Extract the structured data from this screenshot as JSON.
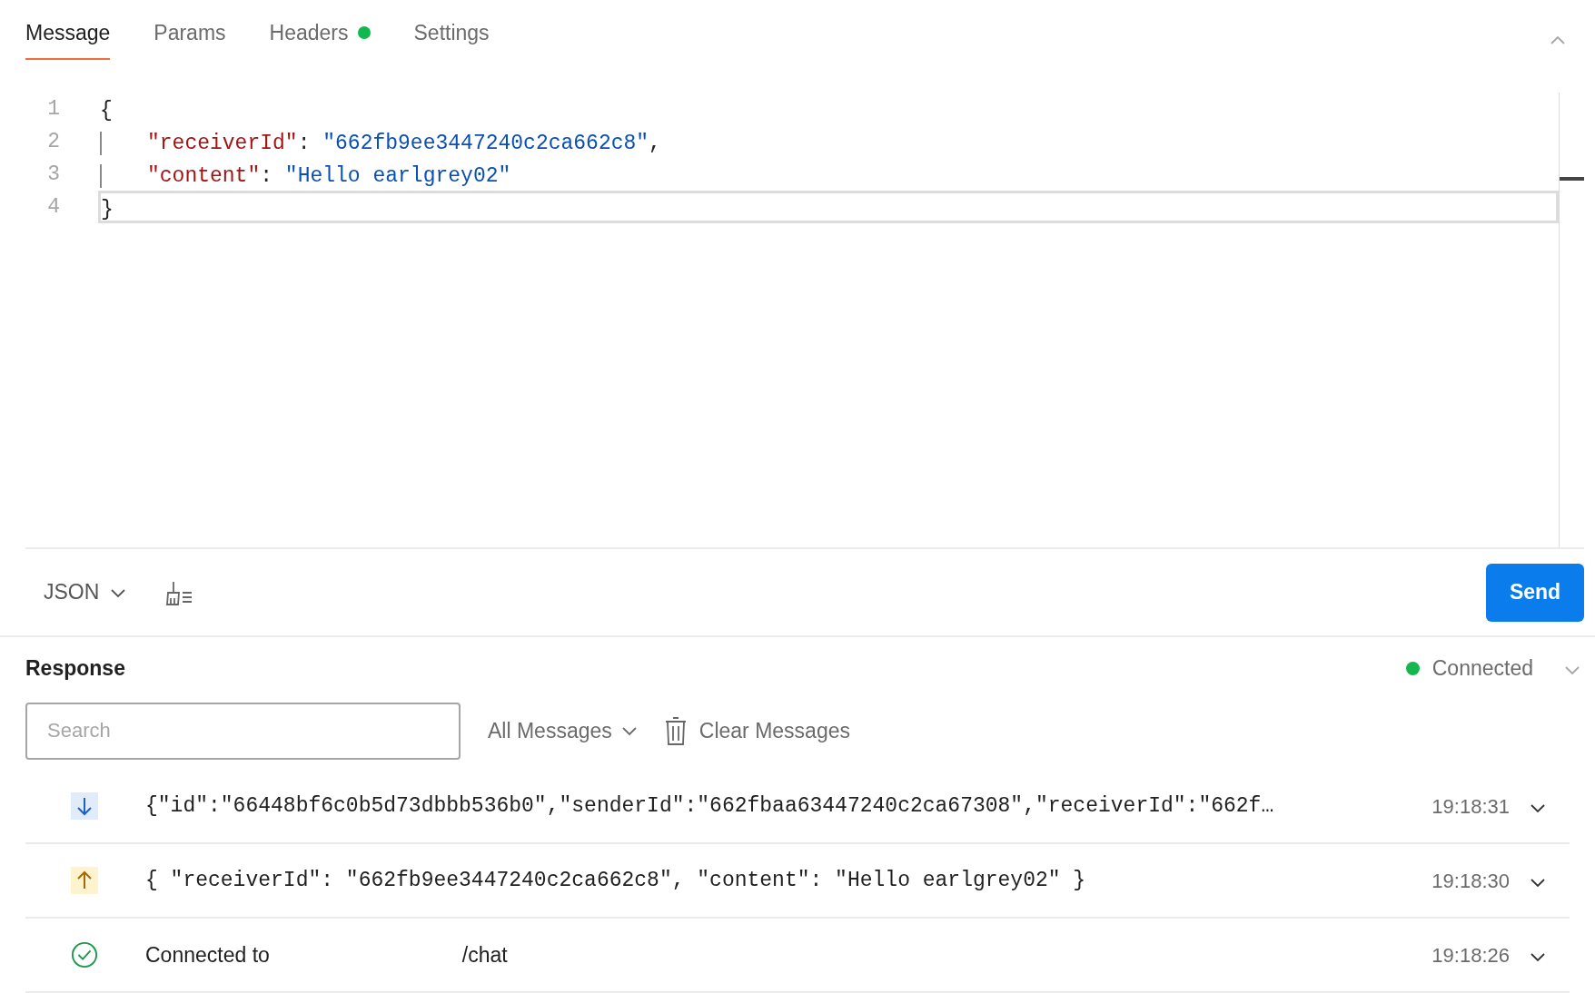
{
  "tabs": [
    {
      "label": "Message",
      "selected": true,
      "indicator": false
    },
    {
      "label": "Params",
      "selected": false,
      "indicator": false
    },
    {
      "label": "Headers",
      "selected": false,
      "indicator": true
    },
    {
      "label": "Settings",
      "selected": false,
      "indicator": false
    }
  ],
  "editor": {
    "lines": [
      {
        "number": "1",
        "current": false,
        "tokens": [
          {
            "kind": "punct",
            "text": "{"
          }
        ]
      },
      {
        "number": "2",
        "current": false,
        "nested": true,
        "tokens": [
          {
            "kind": "key",
            "text": "\"receiverId\""
          },
          {
            "kind": "punct",
            "text": ": "
          },
          {
            "kind": "string",
            "text": "\"662fb9ee3447240c2ca662c8\""
          },
          {
            "kind": "punct",
            "text": ","
          }
        ]
      },
      {
        "number": "3",
        "current": false,
        "nested": true,
        "tokens": [
          {
            "kind": "key",
            "text": "\"content\""
          },
          {
            "kind": "punct",
            "text": ": "
          },
          {
            "kind": "string",
            "text": "\"Hello earlgrey02\""
          }
        ]
      },
      {
        "number": "4",
        "current": true,
        "tokens": [
          {
            "kind": "punct",
            "text": "}"
          }
        ]
      }
    ]
  },
  "toolbar": {
    "format": "JSON",
    "send": "Send"
  },
  "response": {
    "title": "Response",
    "status": "Connected",
    "search": {
      "placeholder": "Search"
    },
    "filter": "All Messages",
    "clear": "Clear Messages",
    "messages": [
      {
        "kind": "incoming",
        "text": "{\"id\":\"66448bf6c0b5d73dbbb536b0\",\"senderId\":\"662fbaa63447240c2ca67308\",\"receiverId\":\"662f…",
        "time": "19:18:31"
      },
      {
        "kind": "outgoing",
        "text": "{ \"receiverId\": \"662fb9ee3447240c2ca662c8\", \"content\": \"Hello earlgrey02\" }",
        "time": "19:18:30"
      },
      {
        "kind": "connected",
        "text": "Connected to",
        "path": "/chat",
        "time": "19:18:26"
      }
    ]
  }
}
